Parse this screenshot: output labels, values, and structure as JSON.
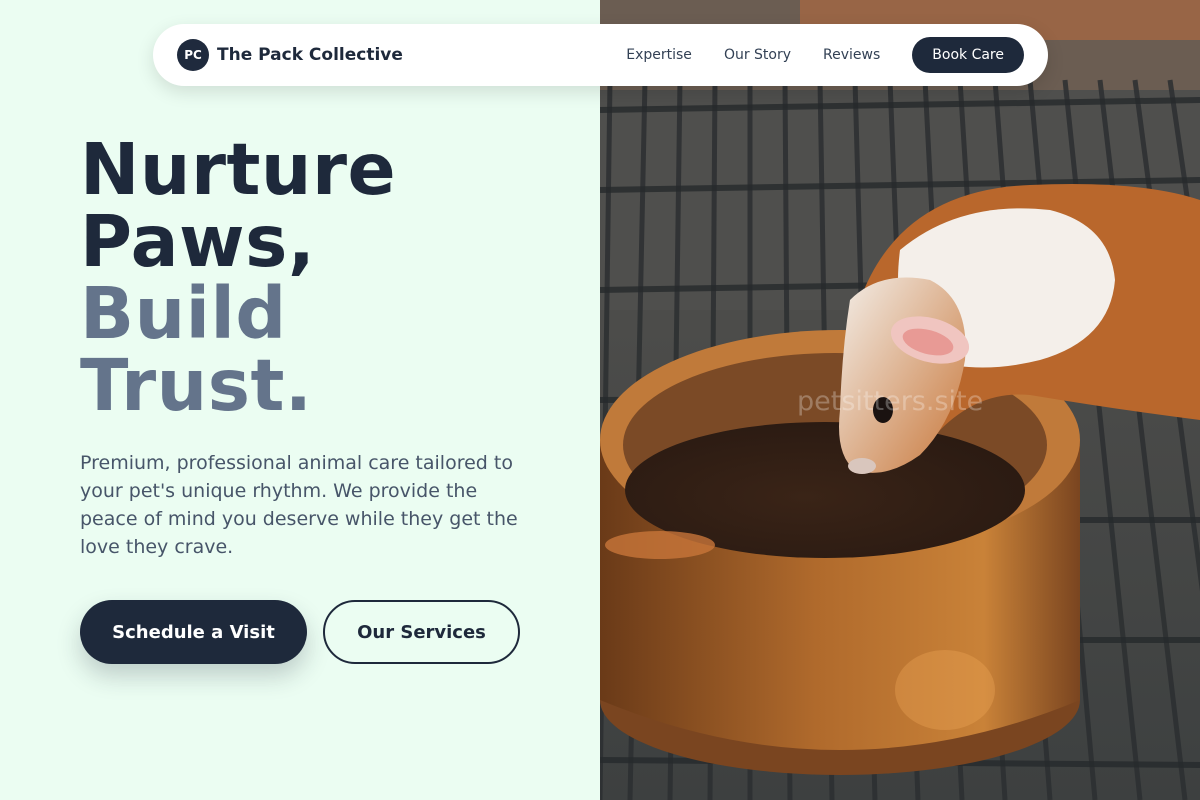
{
  "nav": {
    "logo_initials": "PC",
    "brand_name": "The Pack Collective",
    "links": [
      "Expertise",
      "Our Story",
      "Reviews"
    ],
    "cta_label": "Book Care"
  },
  "hero": {
    "headline_line1": "Nurture",
    "headline_line2": "Paws,",
    "headline_line3": "Build",
    "headline_line4": "Trust.",
    "subcopy": "Premium, professional animal care tailored to your pet's unique rhythm. We provide the peace of mind you deserve while they get the love they crave.",
    "primary_button": "Schedule a Visit",
    "secondary_button": "Our Services"
  },
  "photo": {
    "watermark": "petsitters.site"
  },
  "colors": {
    "accent_dark": "#1e293b",
    "muted_heading": "#64748b",
    "background_mint": "#ebfdf2"
  }
}
